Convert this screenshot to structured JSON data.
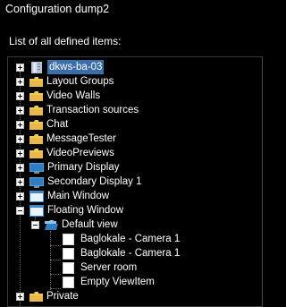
{
  "window": {
    "title": "Configuration dump2",
    "subtitle": "List of all defined items:"
  },
  "tree": {
    "root": {
      "label": "dkws-ba-03",
      "icon": "server-icon",
      "selected": true
    },
    "items": [
      {
        "label": "Layout Groups",
        "icon": "folder-icon"
      },
      {
        "label": "Video Walls",
        "icon": "folder-icon"
      },
      {
        "label": "Transaction sources",
        "icon": "folder-icon"
      },
      {
        "label": "Chat",
        "icon": "folder-icon"
      },
      {
        "label": "MessageTester",
        "icon": "folder-icon"
      },
      {
        "label": "VideoPreviews",
        "icon": "folder-icon"
      },
      {
        "label": "Primary Display",
        "icon": "monitor-icon"
      },
      {
        "label": "Secondary Display 1",
        "icon": "monitor-icon"
      },
      {
        "label": "Main Window",
        "icon": "window-icon"
      },
      {
        "label": "Floating Window",
        "icon": "window-icon",
        "expanded": true
      },
      {
        "label": "Default view",
        "icon": "open-folder-icon",
        "expanded": true
      },
      {
        "label": "Baglokale - Camera 1",
        "icon": "view-item-icon"
      },
      {
        "label": "Baglokale - Camera 1",
        "icon": "view-item-icon"
      },
      {
        "label": "Server room",
        "icon": "view-item-icon"
      },
      {
        "label": "Empty ViewItem",
        "icon": "view-item-icon"
      },
      {
        "label": "Private",
        "icon": "folder-icon"
      }
    ]
  },
  "colors": {
    "background": "#000000",
    "selection": "#3b6ea8",
    "folder": "#f0c65a",
    "text": "#ffffff"
  }
}
